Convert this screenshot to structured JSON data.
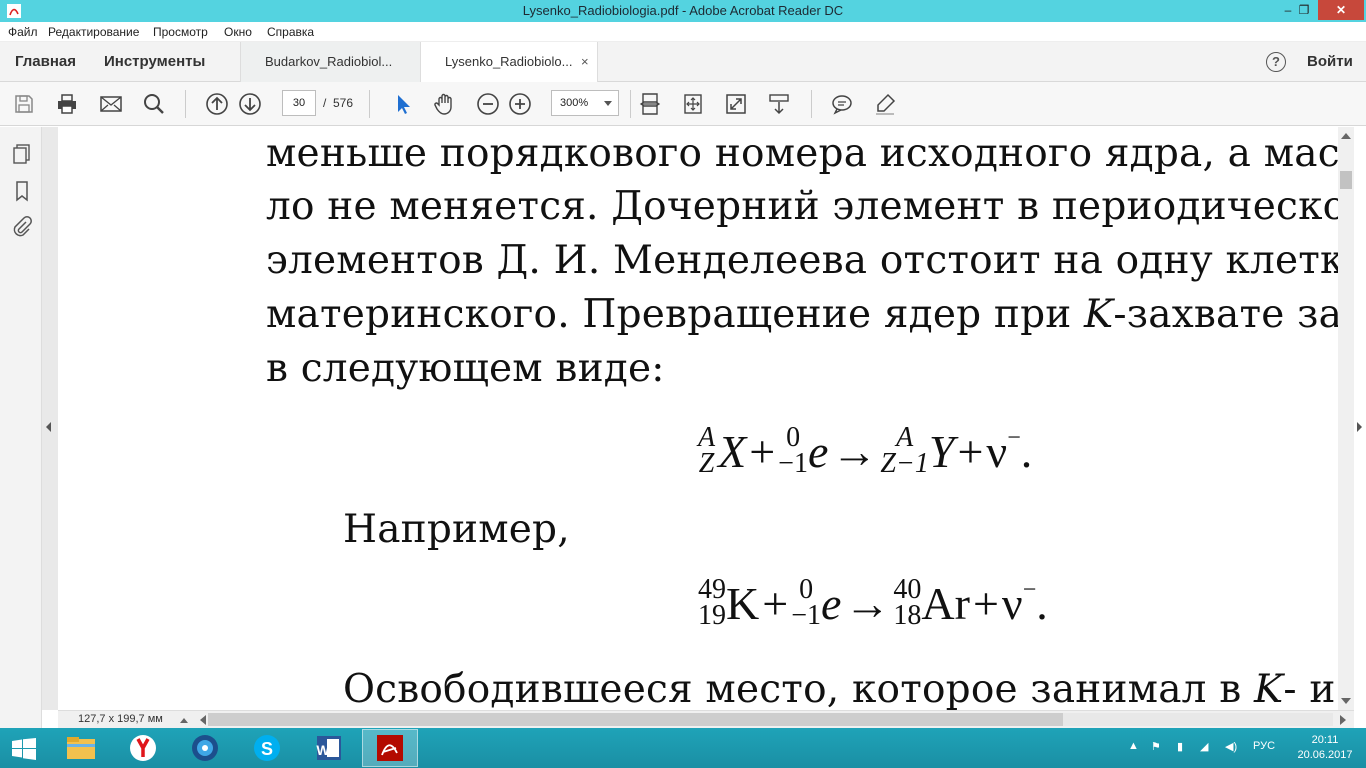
{
  "window": {
    "title": "Lysenko_Radiobiologia.pdf - Adobe Acrobat Reader DC",
    "minimize": "–",
    "maximize": "❐",
    "close": "✕"
  },
  "menu": [
    "Файл",
    "Редактирование",
    "Просмотр",
    "Окно",
    "Справка"
  ],
  "tabs": {
    "home": "Главная",
    "tools": "Инструменты",
    "documents": [
      {
        "label": "Budarkov_Radiobiol..."
      },
      {
        "label": "Lysenko_Radiobiolo...",
        "close": "×"
      }
    ],
    "help": "?",
    "sign_in": "Войти"
  },
  "toolbar": {
    "page_current": "30",
    "page_separator": "/",
    "page_total": "576",
    "zoom": "300%"
  },
  "document": {
    "lines": [
      "меньше порядкового номера исходного ядра, а масс",
      "ло не меняется. Дочерний элемент в периодическо",
      "элементов Д. И. Менделеева отстоит на одну клетку",
      "материнского. Превращение ядер при ",
      "в следующем виде:"
    ],
    "line4_italic": "K",
    "line4_rest": "-захвате зап",
    "formula1": {
      "x_top": "A",
      "x_bottom": "Z",
      "x": "X",
      "plus1": "+",
      "e_top": "0",
      "e_bottom": "−1",
      "e": "e",
      "arrow": "→",
      "y_top": "A",
      "y_bottom": "Z−1",
      "y": "Y",
      "plus2": "+",
      "nu": "ν",
      "nu_sup": "−",
      "dot": "."
    },
    "example": "Например,",
    "formula2": {
      "k_top": "49",
      "k_bottom": "19",
      "k": "K",
      "plus1": "+",
      "e_top": "0",
      "e_bottom": "−1",
      "e": "e",
      "arrow": "→",
      "ar_top": "40",
      "ar_bottom": "18",
      "ar": "Ar",
      "plus2": "+",
      "nu": "ν",
      "nu_sup": "−",
      "dot": "."
    },
    "last_line": "Освободившееся место, которое занимал в ",
    "last_line_italic": "K",
    "last_line_rest": "- и"
  },
  "status": {
    "page_size": "127,7 x 199,7 мм"
  },
  "taskbar": {
    "language": "РУС",
    "time": "20:11",
    "date": "20.06.2017"
  },
  "colors": {
    "titlebar": "#54d3e0",
    "close_button": "#c7483b",
    "taskbar": "#1a8fa4",
    "select_tool": "#1f6fd1"
  }
}
